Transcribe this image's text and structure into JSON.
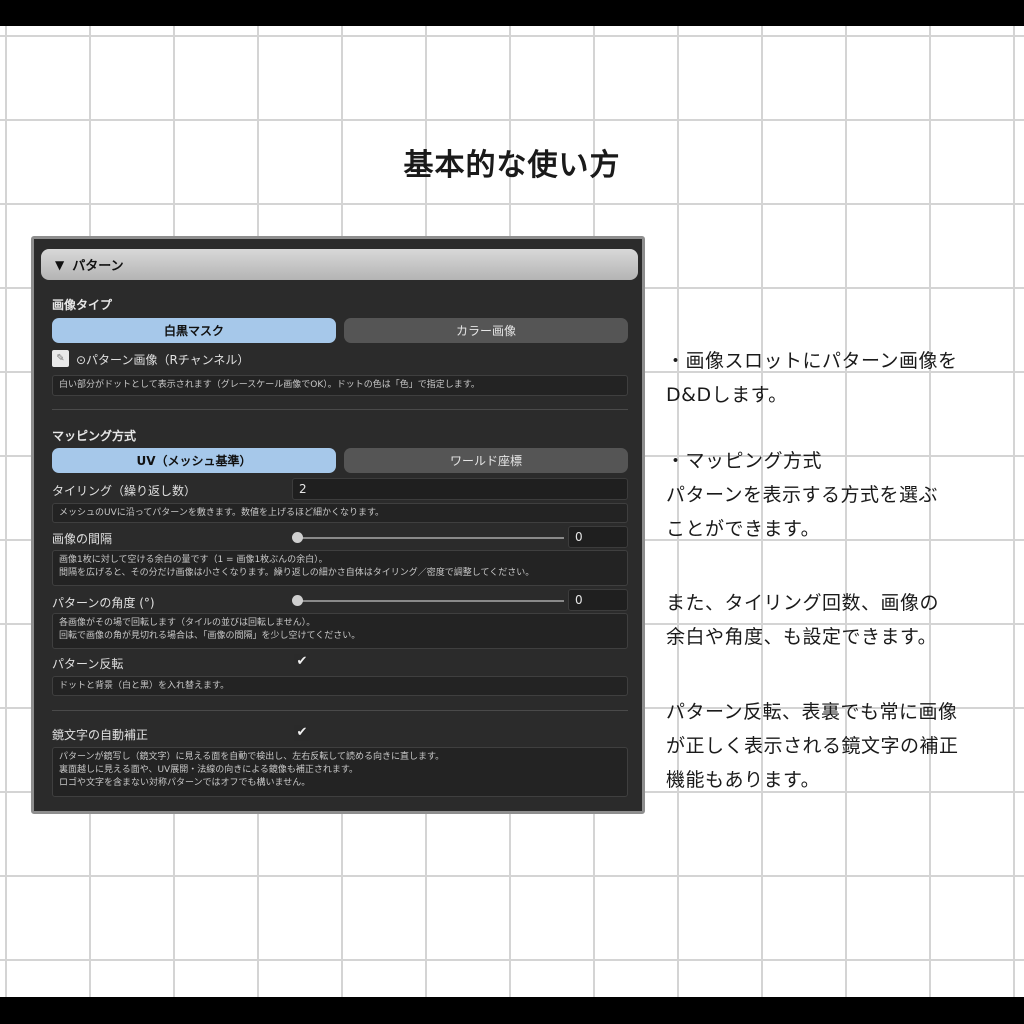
{
  "page_title": "基本的な使い方",
  "panel": {
    "header": "パターン",
    "image_type": {
      "label": "画像タイプ",
      "options": [
        "白黒マスク",
        "カラー画像"
      ],
      "selected": "白黒マスク"
    },
    "slot": {
      "label": "⊙パターン画像（Rチャンネル）",
      "help": "白い部分がドットとして表示されます（グレースケール画像でOK）。ドットの色は「色」で指定します。"
    },
    "mapping": {
      "label": "マッピング方式",
      "options": [
        "UV（メッシュ基準）",
        "ワールド座標"
      ],
      "selected": "UV（メッシュ基準）"
    },
    "tiling": {
      "label": "タイリング（繰り返し数）",
      "value": "2",
      "help": "メッシュのUVに沿ってパターンを敷きます。数値を上げるほど細かくなります。"
    },
    "spacing": {
      "label": "画像の間隔",
      "value": "0",
      "slider_fraction": 0,
      "help": [
        "画像1枚に対して空ける余白の量です（1 = 画像1枚ぶんの余白）。",
        "間隔を広げると、その分だけ画像は小さくなります。繰り返しの細かさ自体はタイリング／密度で調整してください。"
      ]
    },
    "angle": {
      "label": "パターンの角度 (°)",
      "value": "0",
      "slider_fraction": 0,
      "help": [
        "各画像がその場で回転します（タイルの並びは回転しません）。",
        "回転で画像の角が見切れる場合は、「画像の間隔」を少し空けてください。"
      ]
    },
    "invert": {
      "label": "パターン反転",
      "checked": true,
      "check_glyph": "✔",
      "help": "ドットと背景（白と黒）を入れ替えます。"
    },
    "mirror": {
      "label": "鏡文字の自動補正",
      "checked": true,
      "check_glyph": "✔",
      "help": [
        "パターンが鏡写し（鏡文字）に見える面を自動で検出し、左右反転して読める向きに直します。",
        "裏面越しに見える面や、UV展開・法線の向きによる鏡像も補正されます。",
        "ロゴや文字を含まない対称パターンではオフでも構いません。"
      ]
    }
  },
  "description": {
    "block1": [
      "・画像スロットにパターン画像を",
      "D&Dします。"
    ],
    "block2": [
      "・マッピング方式",
      "パターンを表示する方式を選ぶ",
      "ことができます。"
    ],
    "block3": [
      "また、タイリング回数、画像の",
      "余白や角度、も設定できます。"
    ],
    "block4": [
      "パターン反転、表裏でも常に画像",
      "が正しく表示される鏡文字の補正",
      "機能もあります。"
    ]
  },
  "colors": {
    "panel_bg": "#2b2b2b",
    "accent_selected": "#a6c8ea",
    "grid_line": "#d4d4d4"
  }
}
